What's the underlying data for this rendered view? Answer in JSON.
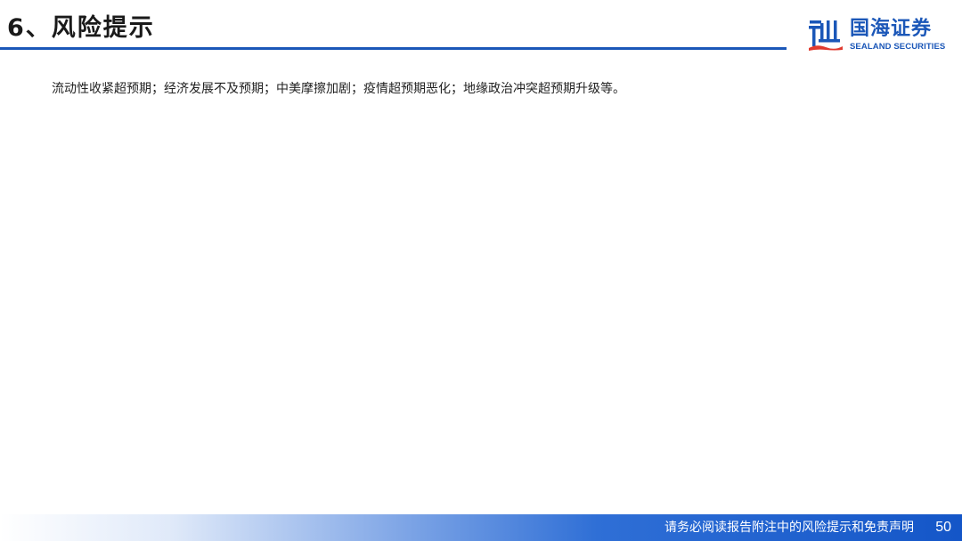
{
  "header": {
    "title": "6、风险提示"
  },
  "logo": {
    "name_cn": "国海证券",
    "name_en": "SEALAND SECURITIES",
    "brand_color": "#1b57b8",
    "accent_color": "#e03a2f"
  },
  "body": {
    "text": "流动性收紧超预期；经济发展不及预期；中美摩擦加剧；疫情超预期恶化；地缘政治冲突超预期升级等。"
  },
  "footer": {
    "disclaimer": "请务必阅读报告附注中的风险提示和免责声明",
    "page_number": "50"
  }
}
